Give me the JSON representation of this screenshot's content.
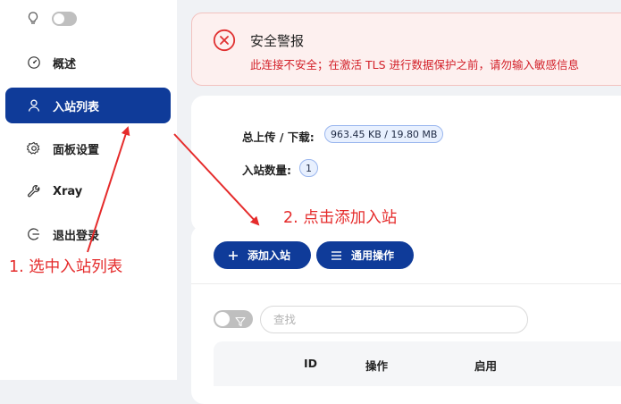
{
  "sidebar": {
    "items": [
      {
        "label": "概述",
        "icon": "dashboard-icon"
      },
      {
        "label": "入站列表",
        "icon": "user-icon",
        "active": true
      },
      {
        "label": "面板设置",
        "icon": "gear-icon"
      },
      {
        "label": "Xray",
        "icon": "wrench-icon"
      },
      {
        "label": "退出登录",
        "icon": "logout-icon"
      }
    ]
  },
  "alert": {
    "title": "安全警报",
    "message": "此连接不安全；在激活 TLS 进行数据保护之前，请勿输入敏感信息"
  },
  "stats": {
    "traffic_label": "总上传 / 下载:",
    "traffic_value": "963.45 KB / 19.80 MB",
    "inbound_count_label": "入站数量:",
    "inbound_count_value": "1"
  },
  "toolbar": {
    "add_label": "添加入站",
    "general_label": "通用操作"
  },
  "search": {
    "placeholder": "查找"
  },
  "table": {
    "columns": [
      "ID",
      "操作",
      "启用"
    ]
  },
  "annotations": {
    "step1": "1. 选中入站列表",
    "step2": "2. 点击添加入站",
    "color": "#e52b2b"
  },
  "colors": {
    "primary": "#0f3b99",
    "alert_bg": "#fdf0ef",
    "alert_text": "#d32029"
  }
}
